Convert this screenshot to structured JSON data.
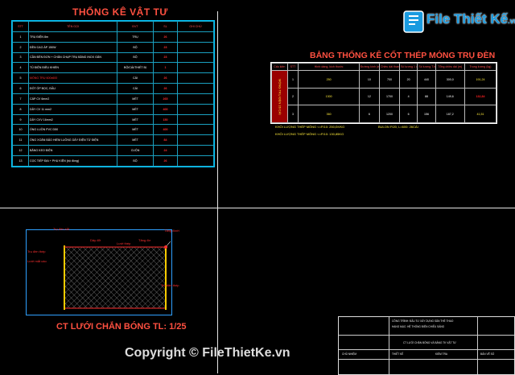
{
  "materials": {
    "title": "THỐNG KÊ VẬT TƯ",
    "headers": [
      "STT",
      "TÊN GỌI",
      "ĐVT",
      "SL",
      "GHI CHÚ"
    ],
    "rows": [
      {
        "stt": "1",
        "name": "TRỤ ĐIỆN 8m",
        "unit": "TRỤ",
        "qty": "26",
        "note": ""
      },
      {
        "stt": "2",
        "name": "ĐÈN CAO ÁP 150W",
        "unit": "BỘ",
        "qty": "23",
        "note": ""
      },
      {
        "stt": "3",
        "name": "CẦN ĐÈN ĐƠN + CHÂN CHỤP TRỤ BẰNG INOX GẮN",
        "unit": "BỘ",
        "qty": "23",
        "note": ""
      },
      {
        "stt": "4",
        "name": "TỦ ĐIỆN ĐIỀU KHIỂN",
        "unit": "BỘ/CÁI/THIẾT BỊ",
        "qty": "1",
        "note": ""
      },
      {
        "stt": "5",
        "name": "MÓNG TRỤ 600x600",
        "unit": "CÁI",
        "qty": "26",
        "note": "",
        "highlight": true
      },
      {
        "stt": "6",
        "name": "ĐỐT ỐP BỌC, ĐẦU",
        "unit": "CÁI",
        "qty": "26",
        "note": ""
      },
      {
        "stt": "7",
        "name": "CÁP CV 6mm2",
        "unit": "MÉT",
        "qty": "265",
        "note": ""
      },
      {
        "stt": "8",
        "name": "DÂY CV 11 mm2",
        "unit": "MÉT",
        "qty": "400",
        "note": ""
      },
      {
        "stt": "9",
        "name": "DÂY CVV 16mm2",
        "unit": "MÉT",
        "qty": "150",
        "note": ""
      },
      {
        "stt": "10",
        "name": "ỐNG LUỒN PVC D50",
        "unit": "MÉT",
        "qty": "400",
        "note": ""
      },
      {
        "stt": "11",
        "name": "ỐNG XOẮN BẢO HIỂM LUỒNG DÂY ĐIỆN TỪ ĐIỆN",
        "unit": "MÉT",
        "qty": "84",
        "note": ""
      },
      {
        "stt": "12",
        "name": "BĂNG KEO ĐIỆN",
        "unit": "CUỘN",
        "qty": "24",
        "note": ""
      },
      {
        "stt": "13",
        "name": "CỌC TIẾP ĐỊA + PHỤ KIỆN (bộ đồng)",
        "unit": "BỘ",
        "qty": "26",
        "note": ""
      }
    ]
  },
  "steel": {
    "title": "BẢNG THỐNG KÊ CỐT THÉP MÓNG TRỤ ĐÈN",
    "headers": [
      "Cấu kiện",
      "STT",
      "Hình dáng, kích thước",
      "Đường kính (mm)",
      "Chiều dài thanh",
      "Số lượng 1 ck",
      "Số lượng T.bộ",
      "Tổng chiều dài (m)",
      "Trọng lượng (kg)"
    ],
    "component": "MÓNG TRỤ ĐÈN 26 CÁI",
    "rows": [
      {
        "stt": "1",
        "shape": "250",
        "dia": "10",
        "len": "700",
        "n1": "20",
        "n2": "440",
        "total": "300,0",
        "weight": "191,24"
      },
      {
        "stt": "2",
        "shape": "1300",
        "dia": "12",
        "len": "1700",
        "n1": "4",
        "n2": "88",
        "total": "149,6",
        "weight": "132,84"
      },
      {
        "stt": "3",
        "shape": "360",
        "dia": "6",
        "len": "1200",
        "n1": "6",
        "n2": "156",
        "total": "187,2",
        "weight": "41,51"
      }
    ],
    "note1": "KHỐI LƯỢNG THÉP MÓNG <=FI10: 250,ĐVKG",
    "note1b": "BULON FI20, L=600: 26CÁI",
    "note2": "KHỐI LƯỢNG THÉP MÓNG <=FI10: 130,85KG"
  },
  "drawing": {
    "caption": "CT LƯỚI CHẮN BÓNG TL: 1/25",
    "labels": [
      "Trụ đèn sắt",
      "Lưới mắt cáo",
      "Dây đỡ",
      "Trụ đèn thép",
      "Tăng đơ",
      "Lưới thép",
      "Tăng đưới",
      "Trụ đèn thép"
    ]
  },
  "title_block": {
    "lines": [
      "CÔNG TRÌNH: ĐẦU TƯ XÂY DỰNG SÂN THỂ THAO",
      "HẠNG MỤC: HỆ THỐNG ĐIỆN CHIẾU SÁNG",
      "CT LƯỚI CHẮN BÓNG VÀ BẢNG TK VẬT TƯ",
      "CHỦ NHIỆM",
      "THIẾT KẾ",
      "KIỂM TRA",
      "BẢN VẼ SỐ"
    ]
  },
  "watermark": {
    "logo": "File Thiết Kế",
    "logo_suffix": ".vn",
    "copyright": "Copyright © FileThietKe.vn"
  }
}
